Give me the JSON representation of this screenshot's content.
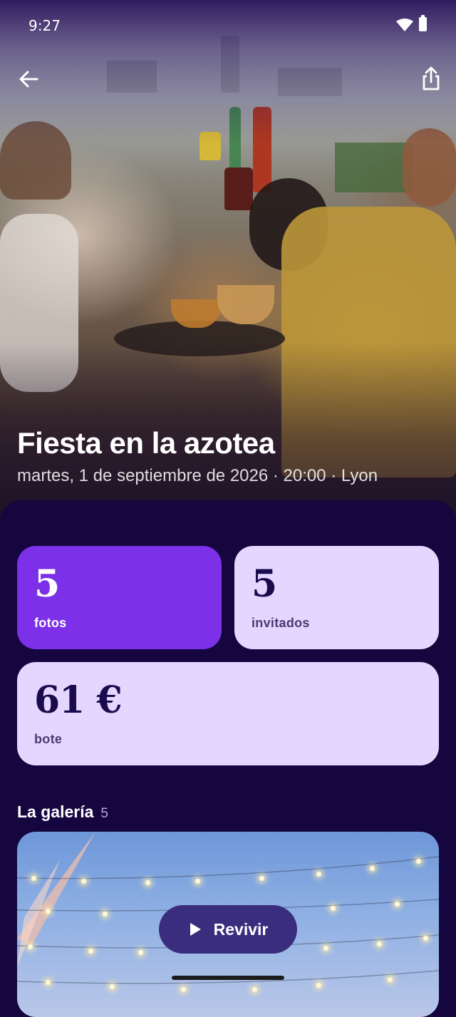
{
  "status_bar": {
    "time": "9:27"
  },
  "colors": {
    "sheet_bg": "#15063f",
    "accent": "#7c30e8",
    "card_light": "#e4d7ff",
    "button": "#3b2d7e"
  },
  "header": {
    "back_icon": "arrow-left-icon",
    "share_icon": "share-icon"
  },
  "event": {
    "title": "Fiesta en la azotea",
    "subtitle": "martes, 1 de septiembre de 2026 · 20:00 · Lyon"
  },
  "stats": {
    "photos": {
      "value": "5",
      "label": "fotos"
    },
    "guests": {
      "value": "5",
      "label": "invitados"
    },
    "pot": {
      "value": "61 €",
      "label": "bote"
    }
  },
  "gallery": {
    "title": "La galería",
    "count": "5",
    "play_label": "Revivir",
    "play_icon": "play-icon"
  }
}
